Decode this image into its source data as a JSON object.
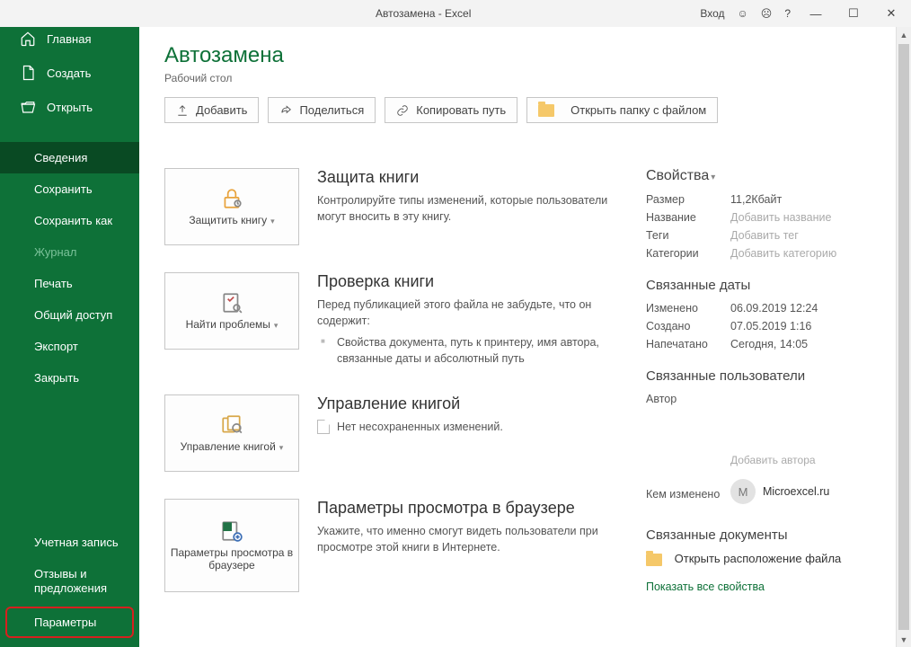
{
  "titlebar": {
    "title": "Автозамена  -  Excel",
    "login": "Вход"
  },
  "sidebar": {
    "items": [
      {
        "label": "Главная"
      },
      {
        "label": "Создать"
      },
      {
        "label": "Открыть"
      },
      {
        "label": "Сведения"
      },
      {
        "label": "Сохранить"
      },
      {
        "label": "Сохранить как"
      },
      {
        "label": "Журнал"
      },
      {
        "label": "Печать"
      },
      {
        "label": "Общий доступ"
      },
      {
        "label": "Экспорт"
      },
      {
        "label": "Закрыть"
      }
    ],
    "bottom": [
      {
        "label": "Учетная запись"
      },
      {
        "label": "Отзывы и предложения"
      },
      {
        "label": "Параметры"
      }
    ]
  },
  "page": {
    "title": "Автозамена",
    "subtitle": "Рабочий стол"
  },
  "actions": {
    "upload": "Добавить",
    "share": "Поделиться",
    "copy": "Копировать путь",
    "open": "Открыть папку с файлом"
  },
  "sections": {
    "protect": {
      "tile": "Защитить книгу",
      "title": "Защита книги",
      "text": "Контролируйте типы изменений, которые пользователи могут вносить в эту книгу."
    },
    "inspect": {
      "tile": "Найти проблемы",
      "title": "Проверка книги",
      "intro": "Перед публикацией этого файла не забудьте, что он содержит:",
      "bullet": "Свойства документа, путь к принтеру, имя автора, связанные даты и абсолютный путь"
    },
    "manage": {
      "tile": "Управление книгой",
      "title": "Управление книгой",
      "text": "Нет несохраненных изменений."
    },
    "browser": {
      "tile": "Параметры просмотра в браузере",
      "title": "Параметры просмотра в браузере",
      "text": "Укажите, что именно смогут видеть пользователи при просмотре этой книги в Интернете."
    }
  },
  "props": {
    "head": "Свойства",
    "rows": {
      "size_k": "Размер",
      "size_v": "11,2Кбайт",
      "title_k": "Название",
      "title_v": "Добавить название",
      "tags_k": "Теги",
      "tags_v": "Добавить тег",
      "cat_k": "Категории",
      "cat_v": "Добавить категорию"
    },
    "dates_head": "Связанные даты",
    "dates": {
      "mod_k": "Изменено",
      "mod_v": "06.09.2019 12:24",
      "cre_k": "Создано",
      "cre_v": "07.05.2019 1:16",
      "prn_k": "Напечатано",
      "prn_v": "Сегодня, 14:05"
    },
    "users_head": "Связанные пользователи",
    "author_k": "Автор",
    "add_author": "Добавить автора",
    "lastmod_k": "Кем изменено",
    "lastmod_v": "Microexcel.ru",
    "lastmod_initial": "M",
    "docs_head": "Связанные документы",
    "open_loc": "Открыть расположение файла",
    "show_all": "Показать все свойства"
  }
}
